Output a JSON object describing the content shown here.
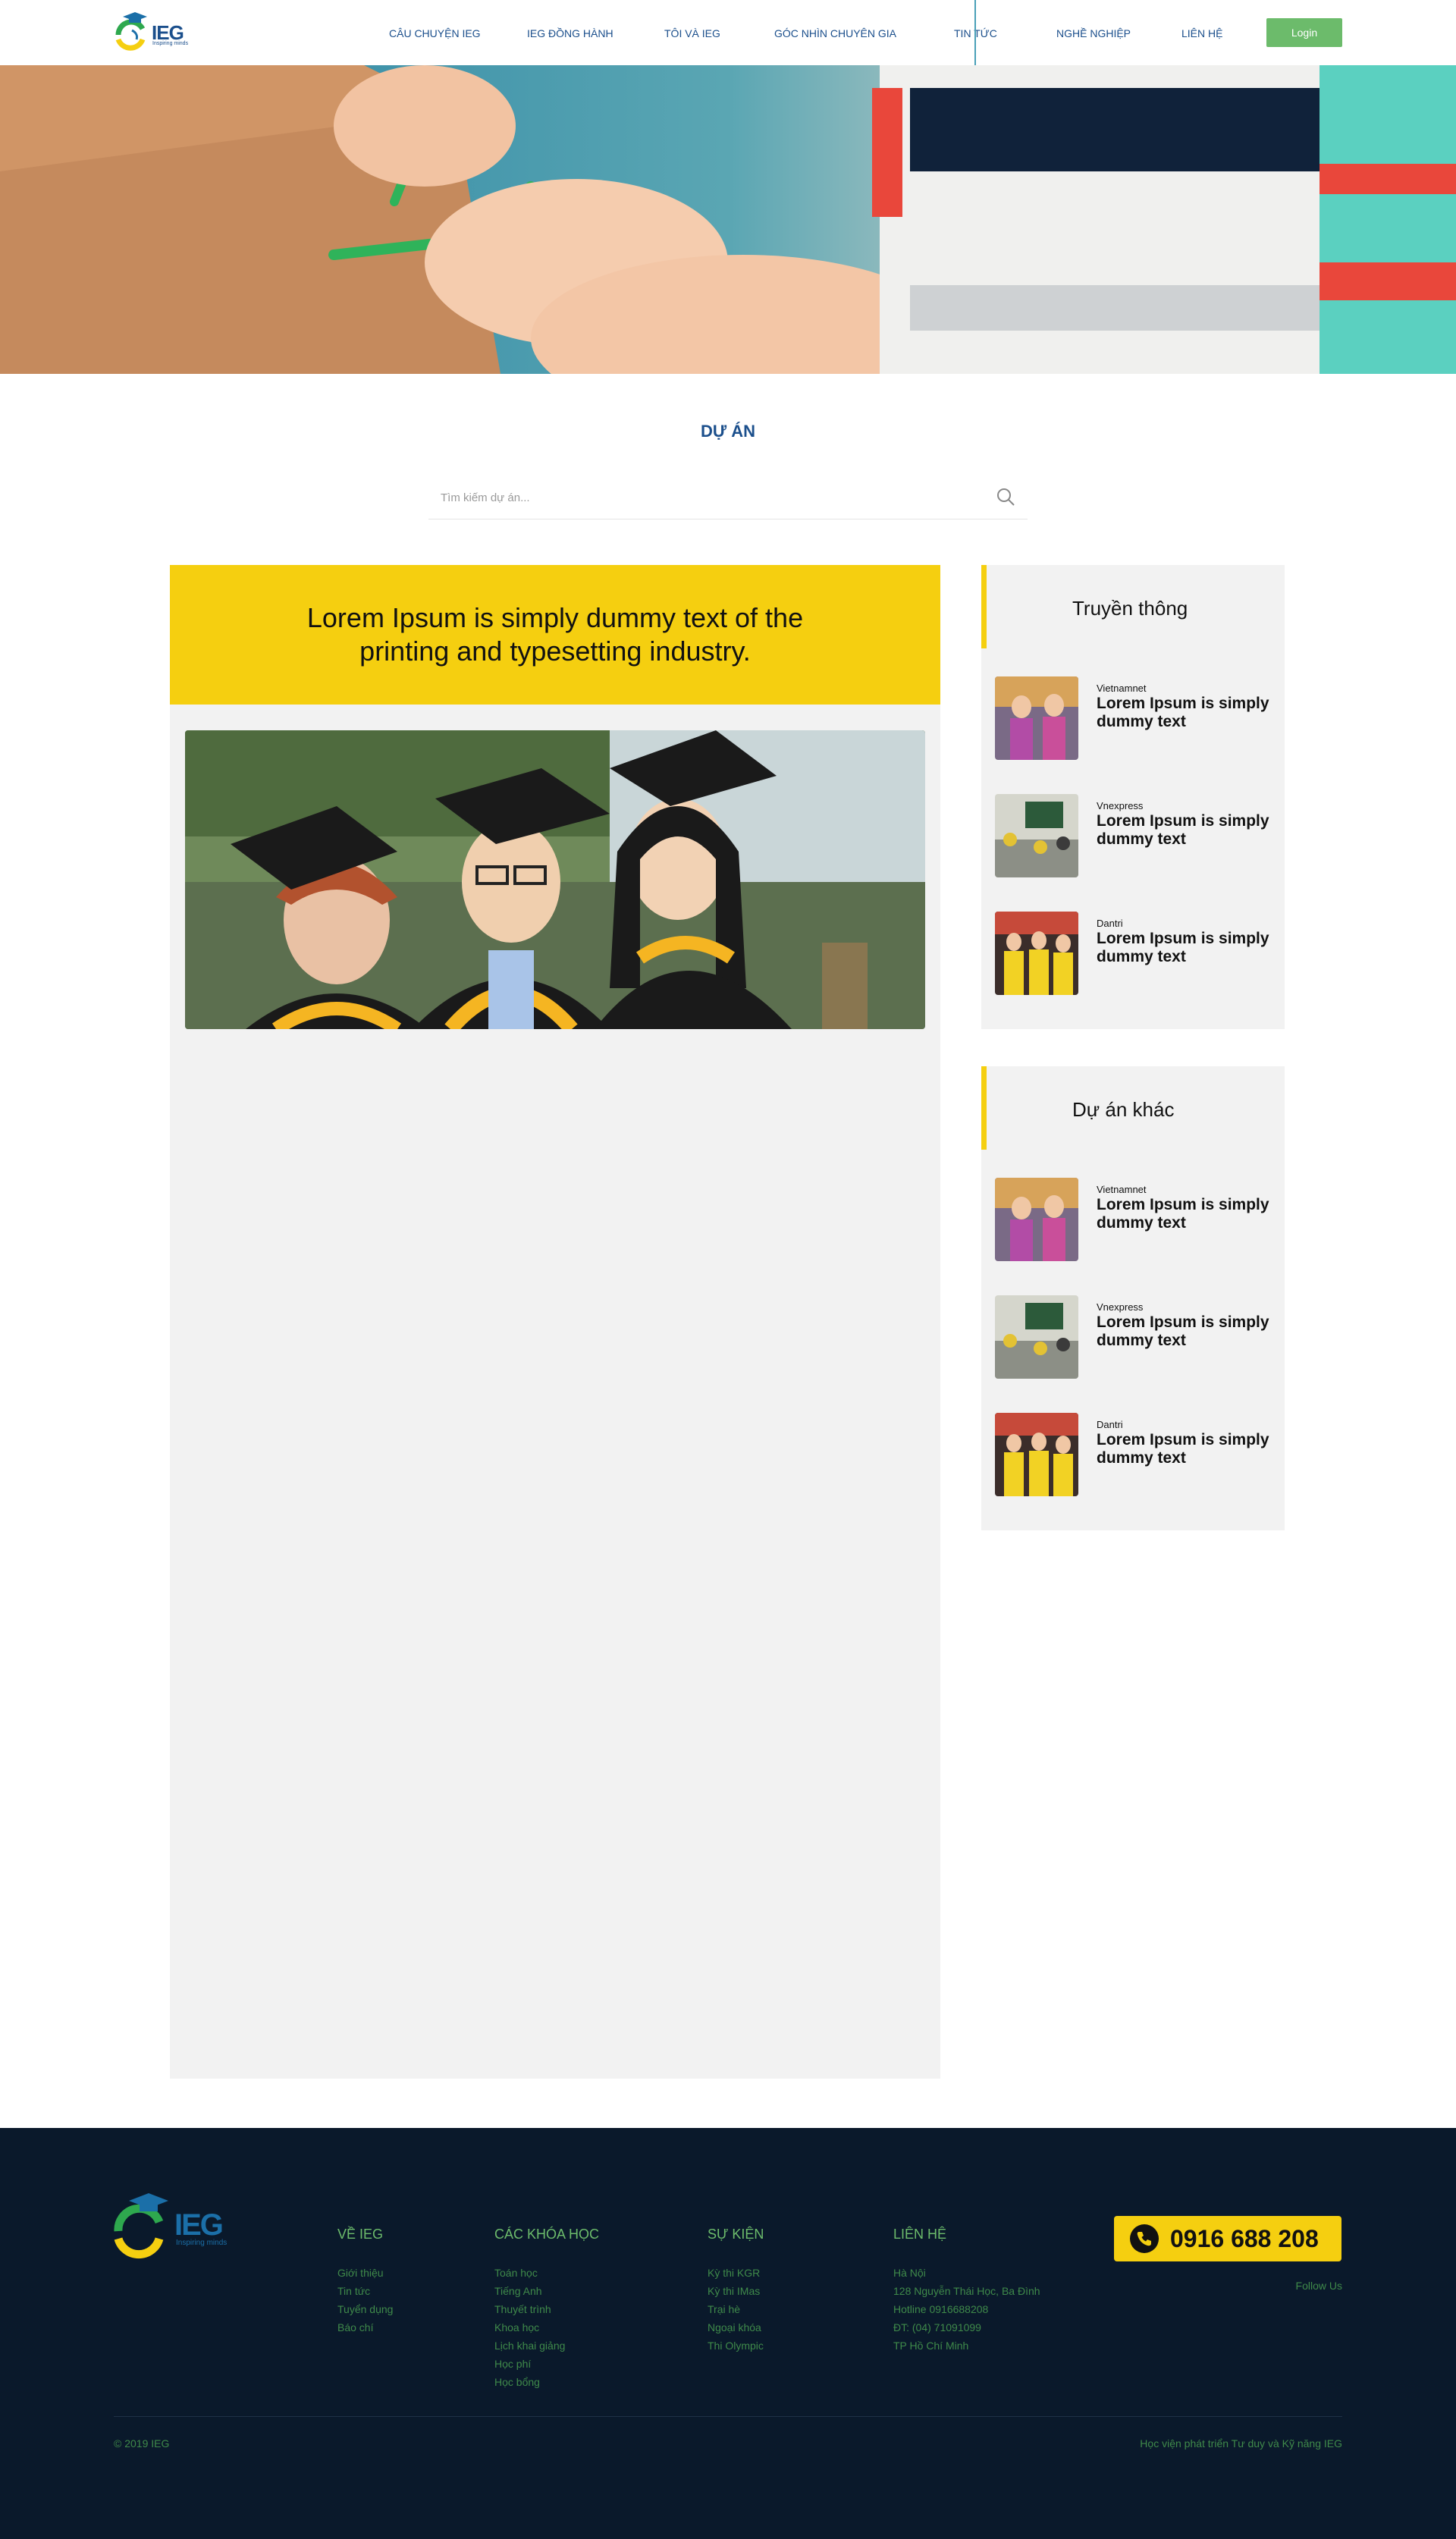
{
  "header": {
    "logo_text": "IEG",
    "logo_subtext": "Inspiring minds",
    "nav": [
      {
        "label": "CÂU CHUYỆN IEG"
      },
      {
        "label": "IEG ĐỒNG HÀNH"
      },
      {
        "label": "TÔI VÀ IEG"
      },
      {
        "label": "GÓC NHÌN CHUYÊN GIA"
      },
      {
        "label": "TIN TỨC"
      },
      {
        "label": "NGHỀ NGHIỆP"
      },
      {
        "label": "LIÊN HỆ"
      }
    ],
    "active_nav": "TIN TỨC",
    "login_label": "Login"
  },
  "page": {
    "title": "DỰ ÁN",
    "search_placeholder": "Tìm kiếm dự án..."
  },
  "main": {
    "headline": "Lorem Ipsum is simply dummy text of the printing and typesetting industry."
  },
  "sidebar": {
    "media": {
      "title": "Truyền thông",
      "items": [
        {
          "source": "Vietnamnet",
          "title": "Lorem Ipsum is simply dummy text"
        },
        {
          "source": "Vnexpress",
          "title": "Lorem Ipsum is simply dummy text"
        },
        {
          "source": "Dantri",
          "title": "Lorem Ipsum is simply dummy text"
        }
      ]
    },
    "other": {
      "title": "Dự án khác",
      "items": [
        {
          "source": "Vietnamnet",
          "title": "Lorem Ipsum is simply dummy text"
        },
        {
          "source": "Vnexpress",
          "title": "Lorem Ipsum is simply dummy text"
        },
        {
          "source": "Dantri",
          "title": "Lorem Ipsum is simply dummy text"
        }
      ]
    }
  },
  "footer": {
    "logo_text": "IEG",
    "logo_subtext": "Inspiring minds",
    "columns": {
      "about": {
        "title": "VỀ IEG",
        "links": [
          "Giới thiệu",
          "Tin tức",
          "Tuyển dụng",
          "Báo chí"
        ]
      },
      "courses": {
        "title": "CÁC KHÓA HỌC",
        "links": [
          "Toán học",
          "Tiếng Anh",
          "Thuyết trình",
          "Khoa học",
          "Lịch khai giảng",
          "Học phí",
          "Học bổng"
        ]
      },
      "events": {
        "title": "SỰ KIỆN",
        "links": [
          "Kỳ thi KGR",
          "Kỳ thi IMas",
          "Trại hè",
          "Ngoại khóa",
          "Thi Olympic"
        ]
      },
      "contact": {
        "title": "LIÊN HỆ",
        "lines": [
          "Hà Nội",
          "128 Nguyễn Thái Học, Ba Đình",
          "Hotline 0916688208",
          "ĐT: (04) 71091099",
          "TP Hồ Chí Minh"
        ]
      }
    },
    "hotline": "0916 688 208",
    "follow_label": "Follow Us",
    "copyright": "© 2019 IEG",
    "slogan": "Học viện phát triển Tư duy và Kỹ năng IEG"
  },
  "colors": {
    "brand_blue": "#1b4f8c",
    "accent_yellow": "#f5cf10",
    "login_green": "#6cbb6b",
    "footer_bg": "#0a192b",
    "footer_text": "#3f8a4a"
  }
}
